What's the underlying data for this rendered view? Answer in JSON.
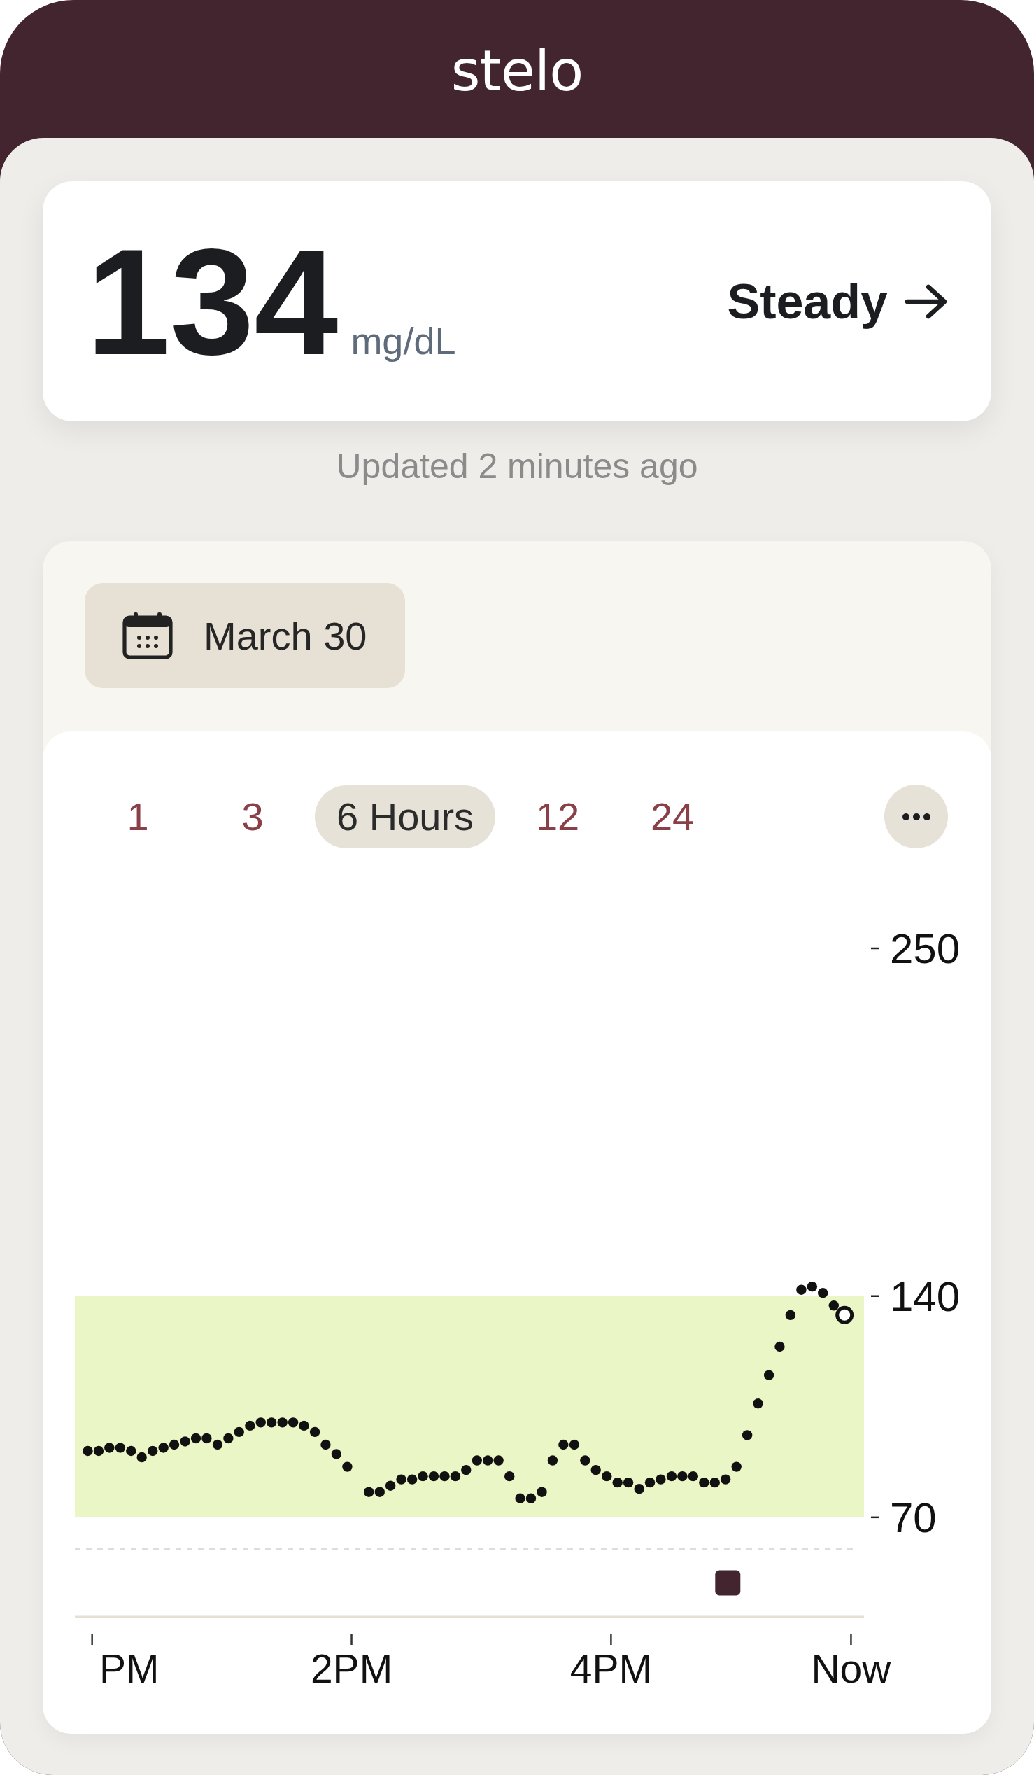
{
  "header": {
    "logo": "stelo"
  },
  "reading": {
    "value": "134",
    "unit": "mg/dL",
    "trend": "Steady",
    "updated": "Updated 2 minutes ago"
  },
  "history": {
    "date": "March 30",
    "ranges": [
      {
        "label": "1",
        "selected": false
      },
      {
        "label": "3",
        "selected": false
      },
      {
        "label": "6 Hours",
        "selected": true
      },
      {
        "label": "12",
        "selected": false
      },
      {
        "label": "24",
        "selected": false
      }
    ],
    "chart_data": {
      "type": "scatter",
      "x": [
        -0.033,
        0.05,
        0.133,
        0.217,
        0.3,
        0.383,
        0.467,
        0.55,
        0.633,
        0.717,
        0.8,
        0.883,
        0.967,
        1.05,
        1.133,
        1.217,
        1.3,
        1.383,
        1.467,
        1.55,
        1.633,
        1.717,
        1.8,
        1.883,
        1.967,
        2.133,
        2.217,
        2.3,
        2.383,
        2.467,
        2.55,
        2.633,
        2.717,
        2.8,
        2.883,
        2.967,
        3.05,
        3.133,
        3.217,
        3.3,
        3.383,
        3.467,
        3.55,
        3.633,
        3.717,
        3.8,
        3.883,
        3.967,
        4.05,
        4.133,
        4.217,
        4.3,
        4.383,
        4.467,
        4.55,
        4.633,
        4.717,
        4.8,
        4.883,
        4.967,
        5.05,
        5.133,
        5.217,
        5.3,
        5.383,
        5.467,
        5.55,
        5.633,
        5.717,
        5.8
      ],
      "series": [
        {
          "color": "#111111",
          "values": [
            91,
            91,
            92,
            92,
            91,
            89,
            91,
            92,
            93,
            94,
            95,
            95,
            93,
            95,
            97,
            99,
            100,
            100,
            100,
            100,
            99,
            97,
            93,
            90,
            86,
            78,
            78,
            80,
            82,
            82,
            83,
            83,
            83,
            83,
            85,
            88,
            88,
            88,
            83,
            76,
            76,
            78,
            88,
            93,
            93,
            88,
            85,
            83,
            81,
            81,
            79,
            81,
            82,
            83,
            83,
            83,
            81,
            81,
            82,
            86,
            96,
            106,
            115,
            124,
            134,
            142,
            143,
            141,
            137,
            null
          ]
        },
        {
          "color": "#ffffff",
          "values": [
            null,
            null,
            null,
            null,
            null,
            null,
            null,
            null,
            null,
            null,
            null,
            null,
            null,
            null,
            null,
            null,
            null,
            null,
            null,
            null,
            null,
            null,
            null,
            null,
            null,
            null,
            null,
            null,
            null,
            null,
            null,
            null,
            null,
            null,
            null,
            null,
            null,
            null,
            null,
            null,
            null,
            null,
            null,
            null,
            null,
            null,
            null,
            null,
            null,
            null,
            null,
            null,
            null,
            null,
            null,
            null,
            null,
            null,
            null,
            null,
            null,
            null,
            null,
            null,
            null,
            null,
            null,
            null,
            null,
            134
          ]
        }
      ],
      "xlim": [
        -0.133,
        5.95
      ],
      "ylim": [
        60,
        250
      ],
      "xticks": [
        {
          "value": 0,
          "label": "PM"
        },
        {
          "value": 2,
          "label": "2PM"
        },
        {
          "value": 4,
          "label": "4PM"
        },
        {
          "value": 5.85,
          "label": "Now"
        }
      ],
      "yticks": [
        70,
        140,
        250
      ],
      "bands": [
        {
          "axis": "y",
          "from": 70,
          "to": 140
        }
      ]
    }
  }
}
